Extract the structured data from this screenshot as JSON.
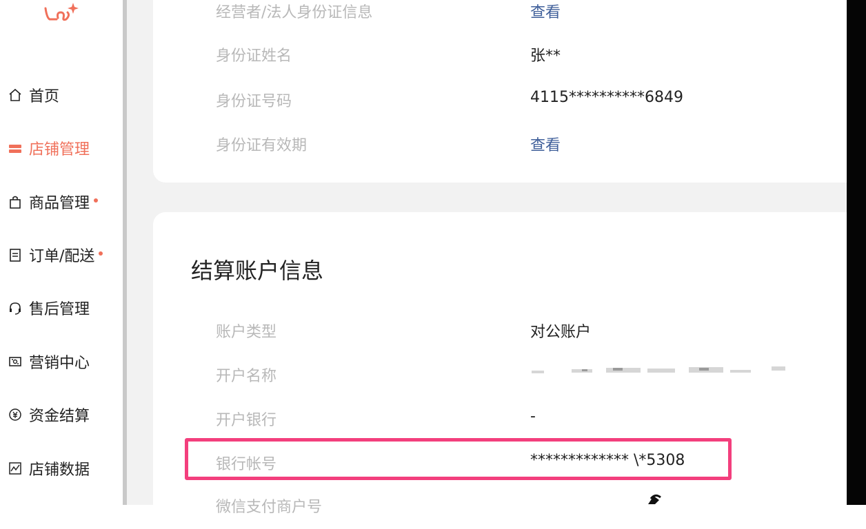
{
  "sidebar": {
    "items": [
      {
        "label": "首页",
        "icon": "home-icon",
        "active": false,
        "dot": false
      },
      {
        "label": "店铺管理",
        "icon": "store-icon",
        "active": true,
        "dot": false
      },
      {
        "label": "商品管理",
        "icon": "shopping-bag-icon",
        "active": false,
        "dot": true
      },
      {
        "label": "订单/配送",
        "icon": "calendar-icon",
        "active": false,
        "dot": true
      },
      {
        "label": "售后管理",
        "icon": "headset-icon",
        "active": false,
        "dot": false
      },
      {
        "label": "营销中心",
        "icon": "ticket-icon",
        "active": false,
        "dot": false
      },
      {
        "label": "资金结算",
        "icon": "yuan-icon",
        "active": false,
        "dot": false
      },
      {
        "label": "店铺数据",
        "icon": "chart-icon",
        "active": false,
        "dot": false
      }
    ],
    "accent_color": "#f0705a"
  },
  "identity": {
    "rows": [
      {
        "label": "经营者/法人身份证信息",
        "value": "查看"
      },
      {
        "label": "身份证姓名",
        "value": "张**"
      },
      {
        "label": "身份证号码",
        "value": "4115**********6849"
      },
      {
        "label": "身份证有效期",
        "value": "查看"
      }
    ]
  },
  "settlement": {
    "title": "结算账户信息",
    "rows": [
      {
        "label": "账户类型",
        "value": "对公账户"
      },
      {
        "label": "开户名称",
        "value": ""
      },
      {
        "label": "开户银行",
        "value": "-"
      },
      {
        "label": "银行帐号",
        "value": "************* \\*5308"
      },
      {
        "label": "微信支付商户号",
        "value": ""
      }
    ]
  },
  "colors": {
    "link": "#3f5f9a",
    "highlight": "#f33f7d",
    "label": "#b8b8b8"
  }
}
